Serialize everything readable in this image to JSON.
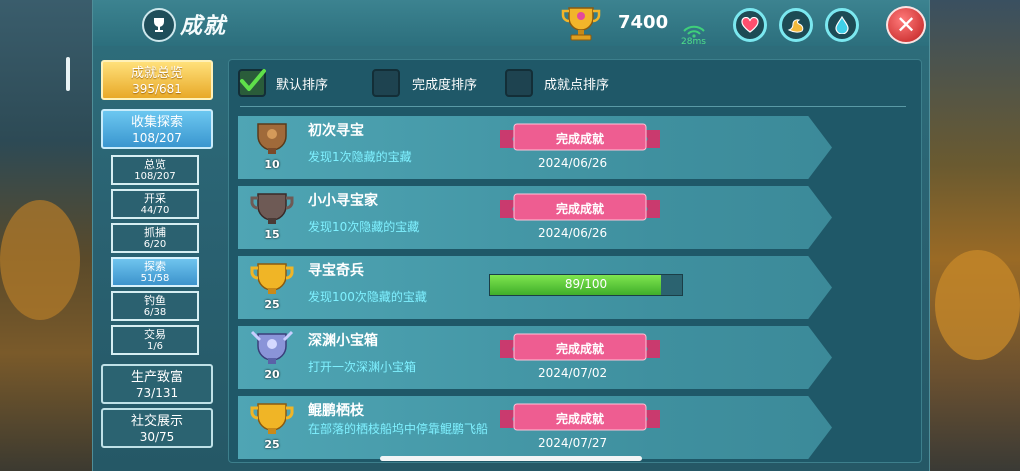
{
  "header": {
    "title": "成就",
    "points": "7400",
    "ping": "28ms",
    "close_label": "✕"
  },
  "status_icons": [
    "heart-icon",
    "muscle-icon",
    "water-drop-icon"
  ],
  "sidebar": {
    "categories": [
      {
        "label": "成就总览",
        "count": "395/681",
        "style": "gold"
      },
      {
        "label": "收集探索",
        "count": "108/207",
        "style": "blue"
      },
      {
        "label": "生产致富",
        "count": "73/131",
        "style": "dark"
      },
      {
        "label": "社交展示",
        "count": "30/75",
        "style": "dark"
      }
    ],
    "subitems": [
      {
        "label": "总览",
        "count": "108/207"
      },
      {
        "label": "开采",
        "count": "44/70"
      },
      {
        "label": "抓捕",
        "count": "6/20"
      },
      {
        "label": "探索",
        "count": "51/58",
        "active": true
      },
      {
        "label": "钓鱼",
        "count": "6/38"
      },
      {
        "label": "交易",
        "count": "1/6"
      }
    ]
  },
  "sort": {
    "options": [
      {
        "label": "默认排序",
        "checked": true
      },
      {
        "label": "完成度排序",
        "checked": false
      },
      {
        "label": "成就点排序",
        "checked": false
      }
    ]
  },
  "achievements": [
    {
      "name": "初次寻宝",
      "desc": "发现1次隐藏的宝藏",
      "points": "10",
      "medal": "bronze",
      "status": "完成成就",
      "date": "2024/06/26"
    },
    {
      "name": "小小寻宝家",
      "desc": "发现10次隐藏的宝藏",
      "points": "15",
      "medal": "iron",
      "status": "完成成就",
      "date": "2024/06/26"
    },
    {
      "name": "寻宝奇兵",
      "desc": "发现100次隐藏的宝藏",
      "points": "25",
      "medal": "gold",
      "progress_text": "89/100",
      "progress": 0.89
    },
    {
      "name": "深渊小宝箱",
      "desc": "打开一次深渊小宝箱",
      "points": "20",
      "medal": "silver",
      "status": "完成成就",
      "date": "2024/07/02"
    },
    {
      "name": "鲲鹏栖枝",
      "desc": "在部落的栖枝船坞中停靠鲲鹏飞船",
      "points": "25",
      "medal": "gold",
      "status": "完成成就",
      "date": "2024/07/27"
    }
  ],
  "colors": {
    "bronze": "#a06a3a",
    "iron": "#6e5a55",
    "gold": "#f0b526",
    "silver": "#8a94d8",
    "ribbon": "#ee5d91"
  }
}
